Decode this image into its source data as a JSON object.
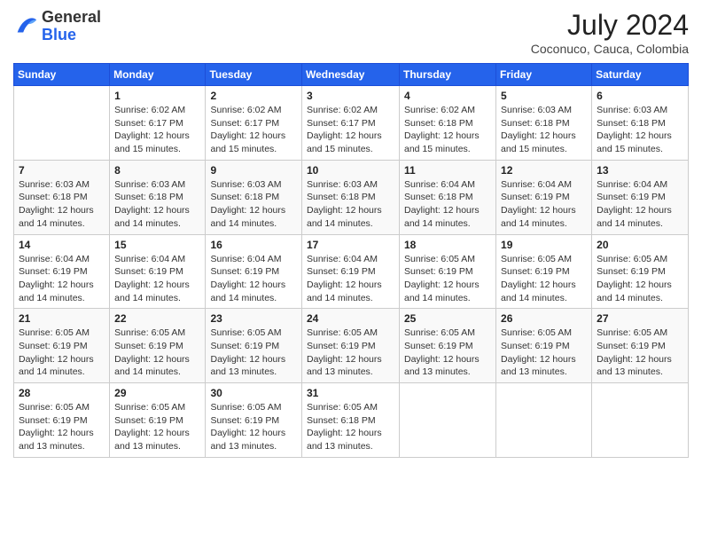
{
  "logo": {
    "text_general": "General",
    "text_blue": "Blue"
  },
  "header": {
    "month_year": "July 2024",
    "location": "Coconuco, Cauca, Colombia"
  },
  "weekdays": [
    "Sunday",
    "Monday",
    "Tuesday",
    "Wednesday",
    "Thursday",
    "Friday",
    "Saturday"
  ],
  "weeks": [
    [
      {
        "day": "",
        "sunrise": "",
        "sunset": "",
        "daylight": ""
      },
      {
        "day": "1",
        "sunrise": "Sunrise: 6:02 AM",
        "sunset": "Sunset: 6:17 PM",
        "daylight": "Daylight: 12 hours and 15 minutes."
      },
      {
        "day": "2",
        "sunrise": "Sunrise: 6:02 AM",
        "sunset": "Sunset: 6:17 PM",
        "daylight": "Daylight: 12 hours and 15 minutes."
      },
      {
        "day": "3",
        "sunrise": "Sunrise: 6:02 AM",
        "sunset": "Sunset: 6:17 PM",
        "daylight": "Daylight: 12 hours and 15 minutes."
      },
      {
        "day": "4",
        "sunrise": "Sunrise: 6:02 AM",
        "sunset": "Sunset: 6:18 PM",
        "daylight": "Daylight: 12 hours and 15 minutes."
      },
      {
        "day": "5",
        "sunrise": "Sunrise: 6:03 AM",
        "sunset": "Sunset: 6:18 PM",
        "daylight": "Daylight: 12 hours and 15 minutes."
      },
      {
        "day": "6",
        "sunrise": "Sunrise: 6:03 AM",
        "sunset": "Sunset: 6:18 PM",
        "daylight": "Daylight: 12 hours and 15 minutes."
      }
    ],
    [
      {
        "day": "7",
        "sunrise": "Sunrise: 6:03 AM",
        "sunset": "Sunset: 6:18 PM",
        "daylight": "Daylight: 12 hours and 14 minutes."
      },
      {
        "day": "8",
        "sunrise": "Sunrise: 6:03 AM",
        "sunset": "Sunset: 6:18 PM",
        "daylight": "Daylight: 12 hours and 14 minutes."
      },
      {
        "day": "9",
        "sunrise": "Sunrise: 6:03 AM",
        "sunset": "Sunset: 6:18 PM",
        "daylight": "Daylight: 12 hours and 14 minutes."
      },
      {
        "day": "10",
        "sunrise": "Sunrise: 6:03 AM",
        "sunset": "Sunset: 6:18 PM",
        "daylight": "Daylight: 12 hours and 14 minutes."
      },
      {
        "day": "11",
        "sunrise": "Sunrise: 6:04 AM",
        "sunset": "Sunset: 6:18 PM",
        "daylight": "Daylight: 12 hours and 14 minutes."
      },
      {
        "day": "12",
        "sunrise": "Sunrise: 6:04 AM",
        "sunset": "Sunset: 6:19 PM",
        "daylight": "Daylight: 12 hours and 14 minutes."
      },
      {
        "day": "13",
        "sunrise": "Sunrise: 6:04 AM",
        "sunset": "Sunset: 6:19 PM",
        "daylight": "Daylight: 12 hours and 14 minutes."
      }
    ],
    [
      {
        "day": "14",
        "sunrise": "Sunrise: 6:04 AM",
        "sunset": "Sunset: 6:19 PM",
        "daylight": "Daylight: 12 hours and 14 minutes."
      },
      {
        "day": "15",
        "sunrise": "Sunrise: 6:04 AM",
        "sunset": "Sunset: 6:19 PM",
        "daylight": "Daylight: 12 hours and 14 minutes."
      },
      {
        "day": "16",
        "sunrise": "Sunrise: 6:04 AM",
        "sunset": "Sunset: 6:19 PM",
        "daylight": "Daylight: 12 hours and 14 minutes."
      },
      {
        "day": "17",
        "sunrise": "Sunrise: 6:04 AM",
        "sunset": "Sunset: 6:19 PM",
        "daylight": "Daylight: 12 hours and 14 minutes."
      },
      {
        "day": "18",
        "sunrise": "Sunrise: 6:05 AM",
        "sunset": "Sunset: 6:19 PM",
        "daylight": "Daylight: 12 hours and 14 minutes."
      },
      {
        "day": "19",
        "sunrise": "Sunrise: 6:05 AM",
        "sunset": "Sunset: 6:19 PM",
        "daylight": "Daylight: 12 hours and 14 minutes."
      },
      {
        "day": "20",
        "sunrise": "Sunrise: 6:05 AM",
        "sunset": "Sunset: 6:19 PM",
        "daylight": "Daylight: 12 hours and 14 minutes."
      }
    ],
    [
      {
        "day": "21",
        "sunrise": "Sunrise: 6:05 AM",
        "sunset": "Sunset: 6:19 PM",
        "daylight": "Daylight: 12 hours and 14 minutes."
      },
      {
        "day": "22",
        "sunrise": "Sunrise: 6:05 AM",
        "sunset": "Sunset: 6:19 PM",
        "daylight": "Daylight: 12 hours and 14 minutes."
      },
      {
        "day": "23",
        "sunrise": "Sunrise: 6:05 AM",
        "sunset": "Sunset: 6:19 PM",
        "daylight": "Daylight: 12 hours and 13 minutes."
      },
      {
        "day": "24",
        "sunrise": "Sunrise: 6:05 AM",
        "sunset": "Sunset: 6:19 PM",
        "daylight": "Daylight: 12 hours and 13 minutes."
      },
      {
        "day": "25",
        "sunrise": "Sunrise: 6:05 AM",
        "sunset": "Sunset: 6:19 PM",
        "daylight": "Daylight: 12 hours and 13 minutes."
      },
      {
        "day": "26",
        "sunrise": "Sunrise: 6:05 AM",
        "sunset": "Sunset: 6:19 PM",
        "daylight": "Daylight: 12 hours and 13 minutes."
      },
      {
        "day": "27",
        "sunrise": "Sunrise: 6:05 AM",
        "sunset": "Sunset: 6:19 PM",
        "daylight": "Daylight: 12 hours and 13 minutes."
      }
    ],
    [
      {
        "day": "28",
        "sunrise": "Sunrise: 6:05 AM",
        "sunset": "Sunset: 6:19 PM",
        "daylight": "Daylight: 12 hours and 13 minutes."
      },
      {
        "day": "29",
        "sunrise": "Sunrise: 6:05 AM",
        "sunset": "Sunset: 6:19 PM",
        "daylight": "Daylight: 12 hours and 13 minutes."
      },
      {
        "day": "30",
        "sunrise": "Sunrise: 6:05 AM",
        "sunset": "Sunset: 6:19 PM",
        "daylight": "Daylight: 12 hours and 13 minutes."
      },
      {
        "day": "31",
        "sunrise": "Sunrise: 6:05 AM",
        "sunset": "Sunset: 6:18 PM",
        "daylight": "Daylight: 12 hours and 13 minutes."
      },
      {
        "day": "",
        "sunrise": "",
        "sunset": "",
        "daylight": ""
      },
      {
        "day": "",
        "sunrise": "",
        "sunset": "",
        "daylight": ""
      },
      {
        "day": "",
        "sunrise": "",
        "sunset": "",
        "daylight": ""
      }
    ]
  ]
}
